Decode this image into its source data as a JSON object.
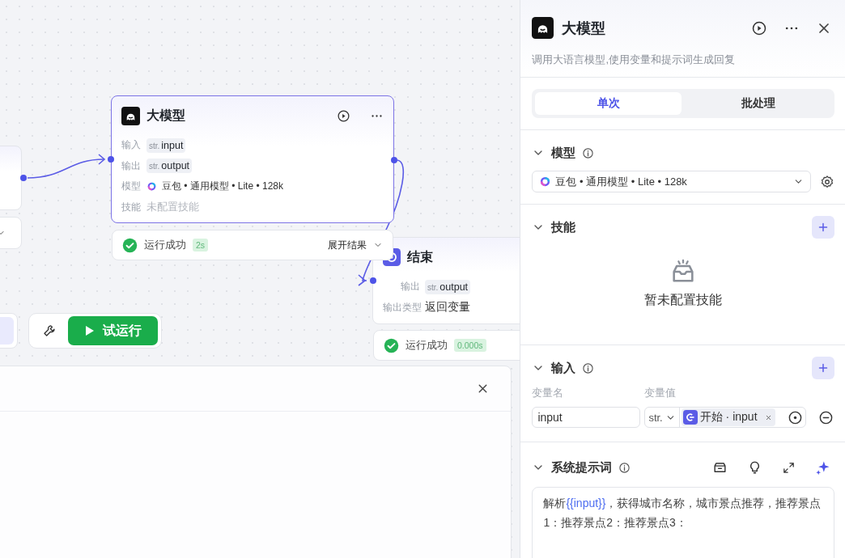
{
  "canvas": {
    "llm_node": {
      "title": "大模型",
      "rows": [
        {
          "kind": "variable",
          "label": "输入",
          "type": "str.",
          "value": "input"
        },
        {
          "kind": "variable",
          "label": "输出",
          "type": "str.",
          "value": "output"
        },
        {
          "kind": "model",
          "label": "模型",
          "value": "豆包 • 通用模型 • Lite • 128k"
        },
        {
          "kind": "empty",
          "label": "技能",
          "value": "未配置技能"
        }
      ],
      "status": {
        "text": "运行成功",
        "duration": "2s",
        "toggle": "展开结果"
      }
    },
    "end_node": {
      "title": "结束",
      "rows": [
        {
          "kind": "variable",
          "label": "输出",
          "type": "str.",
          "value": "output"
        },
        {
          "kind": "text",
          "label": "输出类型",
          "value": "返回变量"
        }
      ],
      "status": {
        "text": "运行成功",
        "duration": "0.000s"
      }
    },
    "toolbar": {
      "run_label": "试运行"
    }
  },
  "panel": {
    "title": "大模型",
    "description": "调用大语言模型,使用变量和提示词生成回复",
    "tabs": [
      {
        "label": "单次",
        "selected": true
      },
      {
        "label": "批处理",
        "selected": false
      }
    ],
    "model": {
      "title": "模型",
      "value": "豆包 • 通用模型 • Lite • 128k"
    },
    "skills": {
      "title": "技能",
      "empty_text": "暂未配置技能"
    },
    "inputs": {
      "title": "输入",
      "columns": [
        "变量名",
        "变量值"
      ],
      "rows": [
        {
          "name": "input",
          "type": "str.",
          "source": "开始 · input"
        }
      ]
    },
    "prompt": {
      "title": "系统提示词",
      "segments": [
        {
          "kind": "text",
          "text": "解析"
        },
        {
          "kind": "variable",
          "text": "{{input}}"
        },
        {
          "kind": "text",
          "text": "，获得城市名称，城市景点推荐，推荐景点1：推荐景点2：推荐景点3："
        }
      ]
    }
  }
}
